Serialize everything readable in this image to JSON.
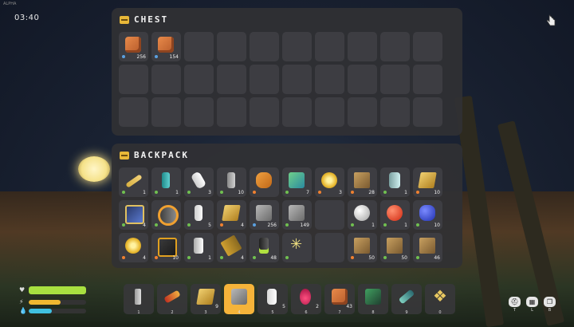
{
  "hud": {
    "clock": "03:40",
    "build": "ALPHA"
  },
  "chest": {
    "title": "CHEST",
    "slots": [
      {
        "item": "crate",
        "count": "256",
        "dot": "#5aa0e0"
      },
      {
        "item": "crate",
        "count": "154",
        "dot": "#5aa0e0"
      },
      {},
      {},
      {},
      {},
      {},
      {},
      {},
      {},
      {},
      {},
      {},
      {},
      {},
      {},
      {},
      {},
      {},
      {},
      {},
      {},
      {},
      {},
      {},
      {},
      {},
      {},
      {},
      {}
    ]
  },
  "backpack": {
    "title": "BACKPACK",
    "slots": [
      {
        "item": "rod",
        "count": "1",
        "dot": "#70c050"
      },
      {
        "item": "cyl",
        "count": "1",
        "dot": "#70c050"
      },
      {
        "item": "white",
        "count": "3",
        "dot": "#70c050"
      },
      {
        "item": "grey",
        "count": "10",
        "dot": "#70c050"
      },
      {
        "item": "orange",
        "count": "",
        "dot": "#f08030"
      },
      {
        "item": "machine",
        "count": "7",
        "dot": "#70c050"
      },
      {
        "item": "coin",
        "count": "3",
        "dot": "#f08030"
      },
      {
        "item": "box",
        "count": "28",
        "dot": "#f08030"
      },
      {
        "item": "tank",
        "count": "1",
        "dot": "#70c050"
      },
      {
        "item": "plate",
        "count": "10",
        "dot": "#f08030"
      },
      {
        "item": "frame",
        "count": "4",
        "dot": "#70c050"
      },
      {
        "item": "pipe",
        "count": "",
        "dot": "#70c050"
      },
      {
        "item": "bottle",
        "count": "5",
        "dot": "#70c050"
      },
      {
        "item": "plate",
        "count": "4",
        "dot": "#f08030"
      },
      {
        "item": "metal",
        "count": "256",
        "dot": "#5aa0e0"
      },
      {
        "item": "metal",
        "count": "149",
        "dot": "#70c050"
      },
      {},
      {
        "item": "ball",
        "count": "1",
        "dot": "#70c050"
      },
      {
        "item": "fruit",
        "count": "1",
        "dot": "#70c050"
      },
      {
        "item": "blob",
        "count": "10",
        "dot": "#70c050"
      },
      {
        "item": "coin",
        "count": "4",
        "dot": "#f08030"
      },
      {
        "item": "chestbox",
        "count": "10",
        "dot": "#f08030"
      },
      {
        "item": "jar",
        "count": "1",
        "dot": "#70c050"
      },
      {
        "item": "battery",
        "count": "4",
        "dot": "#70c050"
      },
      {
        "item": "canister",
        "count": "48",
        "dot": "#70c050"
      },
      {
        "item": "star",
        "count": "",
        "dot": "#70c050"
      },
      {},
      {
        "item": "box",
        "count": "50",
        "dot": "#f08030"
      },
      {
        "item": "box",
        "count": "50",
        "dot": "#70c050"
      },
      {
        "item": "box",
        "count": "46",
        "dot": "#70c050"
      }
    ]
  },
  "hotbar": {
    "selected_index": 3,
    "slots": [
      {
        "item": "hammer",
        "count": "",
        "key": "1"
      },
      {
        "item": "gun",
        "count": "",
        "key": "2"
      },
      {
        "item": "plate",
        "count": "9",
        "key": "3"
      },
      {
        "item": "metal",
        "count": "",
        "key": "4"
      },
      {
        "item": "milk",
        "count": "5",
        "key": "5"
      },
      {
        "item": "radish",
        "count": "2",
        "key": "6"
      },
      {
        "item": "crate",
        "count": "43",
        "key": "7"
      },
      {
        "item": "green-machine",
        "count": "",
        "key": "8"
      },
      {
        "item": "drill",
        "count": "",
        "key": "9"
      },
      {
        "item": "gear",
        "count": "",
        "key": "0"
      }
    ]
  },
  "status": {
    "health": {
      "icon": "heart-icon",
      "level": 1.0,
      "color": "#a8e040"
    },
    "stamina": {
      "icon": "bolt-icon",
      "level": 0.55,
      "color": "#f0b830"
    },
    "water": {
      "icon": "drop-icon",
      "level": 0.4,
      "color": "#40c0e0"
    }
  },
  "corner_buttons": [
    {
      "icon": "helmet-icon",
      "key": "T"
    },
    {
      "icon": "map-icon",
      "key": "L"
    },
    {
      "icon": "book-icon",
      "key": "B"
    }
  ]
}
